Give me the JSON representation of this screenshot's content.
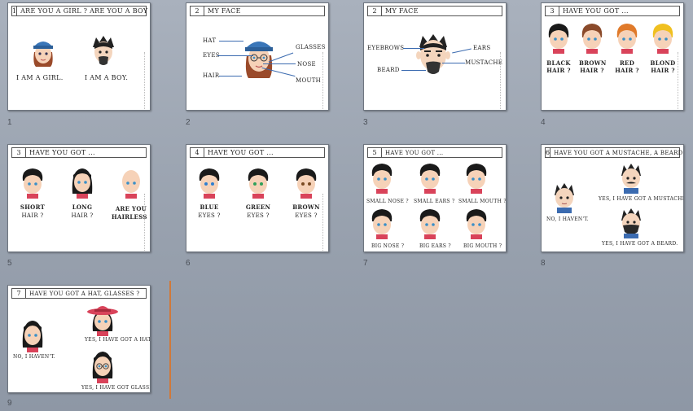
{
  "slides": [
    {
      "number": "1",
      "title_number": "1",
      "title": "ARE YOU A GIRL ? ARE YOU A BOY ?",
      "labels": [
        "I AM A GIRL.",
        "I AM A BOY."
      ]
    },
    {
      "number": "2",
      "title_number": "2",
      "title": "MY FACE",
      "labels": [
        "HAT",
        "EYES",
        "HAIR",
        "GLASSES",
        "NOSE",
        "MOUTH"
      ]
    },
    {
      "number": "3",
      "title_number": "2",
      "title": "MY FACE",
      "labels": [
        "EYEBROWS",
        "BEARD",
        "EARS",
        "MUSTACHE"
      ]
    },
    {
      "number": "4",
      "title_number": "3",
      "title": "HAVE YOU GOT ...",
      "labels": [
        "BLACK",
        "HAIR ?",
        "BROWN",
        "HAIR ?",
        "RED",
        "HAIR ?",
        "BLOND",
        "HAIR ?"
      ]
    },
    {
      "number": "5",
      "title_number": "3",
      "title": "HAVE YOU GOT ...",
      "labels": [
        "SHORT",
        "HAIR ?",
        "LONG",
        "HAIR ?",
        "ARE YOU",
        "HAIRLESS ?"
      ]
    },
    {
      "number": "6",
      "title_number": "4",
      "title": "HAVE YOU GOT ...",
      "labels": [
        "BLUE",
        "EYES ?",
        "GREEN",
        "EYES ?",
        "BROWN",
        "EYES ?"
      ]
    },
    {
      "number": "7",
      "title_number": "5",
      "title": "HAVE YOU GOT ...",
      "labels": [
        "SMALL NOSE ?",
        "SMALL EARS ?",
        "SMALL MOUTH ?",
        "BIG NOSE ?",
        "BIG EARS ?",
        "BIG MOUTH ?"
      ]
    },
    {
      "number": "8",
      "title_number": "6",
      "title": "HAVE YOU GOT A MUSTACHE, A BEARD ?",
      "labels": [
        "NO, I HAVEN'T.",
        "YES, I HAVE GOT A MUSTACHE.",
        "YES, I HAVE GOT A BEARD."
      ]
    },
    {
      "number": "9",
      "title_number": "7",
      "title": "HAVE YOU GOT A HAT, GLASSES ?",
      "labels": [
        "NO, I HAVEN'T.",
        "YES, I HAVE GOT A HAT.",
        "YES, I HAVE GOT GLASSES."
      ]
    }
  ],
  "colors": {
    "background": "#a2aab6",
    "insertion_marker": "#d0793a",
    "leader_line": "#3b6bb0"
  }
}
